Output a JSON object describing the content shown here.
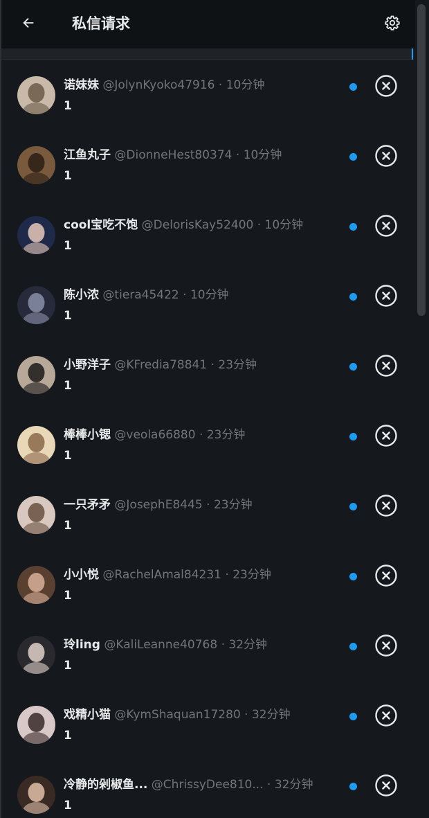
{
  "header": {
    "title": "私信请求",
    "back_icon": "arrow-left-icon",
    "settings_icon": "gear-icon"
  },
  "colors": {
    "accent": "#1d9bf0",
    "background": "#15181c",
    "muted": "#71767b",
    "text": "#e7e9ea"
  },
  "requests": [
    {
      "name": "诺妹妹",
      "handle": "@JolynKyoko47916",
      "sep": "·",
      "time": "10分钟",
      "preview": "1",
      "avatar_bg": "#c9b9a8",
      "avatar_fg": "#6b5a48"
    },
    {
      "name": "江鱼丸子",
      "handle": "@DionneHest80374",
      "sep": "·",
      "time": "10分钟",
      "preview": "1",
      "avatar_bg": "#7a5a3c",
      "avatar_fg": "#2a1e14"
    },
    {
      "name": "cool宝吃不饱",
      "handle": "@DelorisKay52400",
      "sep": "·",
      "time": "10分钟",
      "preview": "1",
      "avatar_bg": "#1f2a4a",
      "avatar_fg": "#e8c8b8"
    },
    {
      "name": "陈小浓",
      "handle": "@tiera45422",
      "sep": "·",
      "time": "10分钟",
      "preview": "1",
      "avatar_bg": "#262a3a",
      "avatar_fg": "#8a8fa8"
    },
    {
      "name": "小野洋子",
      "handle": "@KFredia78841",
      "sep": "·",
      "time": "23分钟",
      "preview": "1",
      "avatar_bg": "#b8a898",
      "avatar_fg": "#1a1a1a"
    },
    {
      "name": "棒棒小锶",
      "handle": "@veola66880",
      "sep": "·",
      "time": "23分钟",
      "preview": "1",
      "avatar_bg": "#e8d8b8",
      "avatar_fg": "#8a6848"
    },
    {
      "name": "一只矛矛",
      "handle": "@JosephE8445",
      "sep": "·",
      "time": "23分钟",
      "preview": "1",
      "avatar_bg": "#d8c8c0",
      "avatar_fg": "#6a5040"
    },
    {
      "name": "小小悦",
      "handle": "@RachelAmal84231",
      "sep": "·",
      "time": "23分钟",
      "preview": "1",
      "avatar_bg": "#5a4030",
      "avatar_fg": "#d8b098"
    },
    {
      "name": "玲ling",
      "handle": "@KaliLeanne40768",
      "sep": "·",
      "time": "32分钟",
      "preview": "1",
      "avatar_bg": "#2a2a2e",
      "avatar_fg": "#e0d0c8"
    },
    {
      "name": "戏精小猫",
      "handle": "@KymShaquan17280",
      "sep": "·",
      "time": "32分钟",
      "preview": "1",
      "avatar_bg": "#d8c8c8",
      "avatar_fg": "#3a2a2a"
    },
    {
      "name": "冷静的剁椒鱼...",
      "handle": "@ChrissyDee810...",
      "sep": "·",
      "time": "32分钟",
      "preview": "1",
      "avatar_bg": "#3a2a24",
      "avatar_fg": "#e0c0a8"
    }
  ]
}
